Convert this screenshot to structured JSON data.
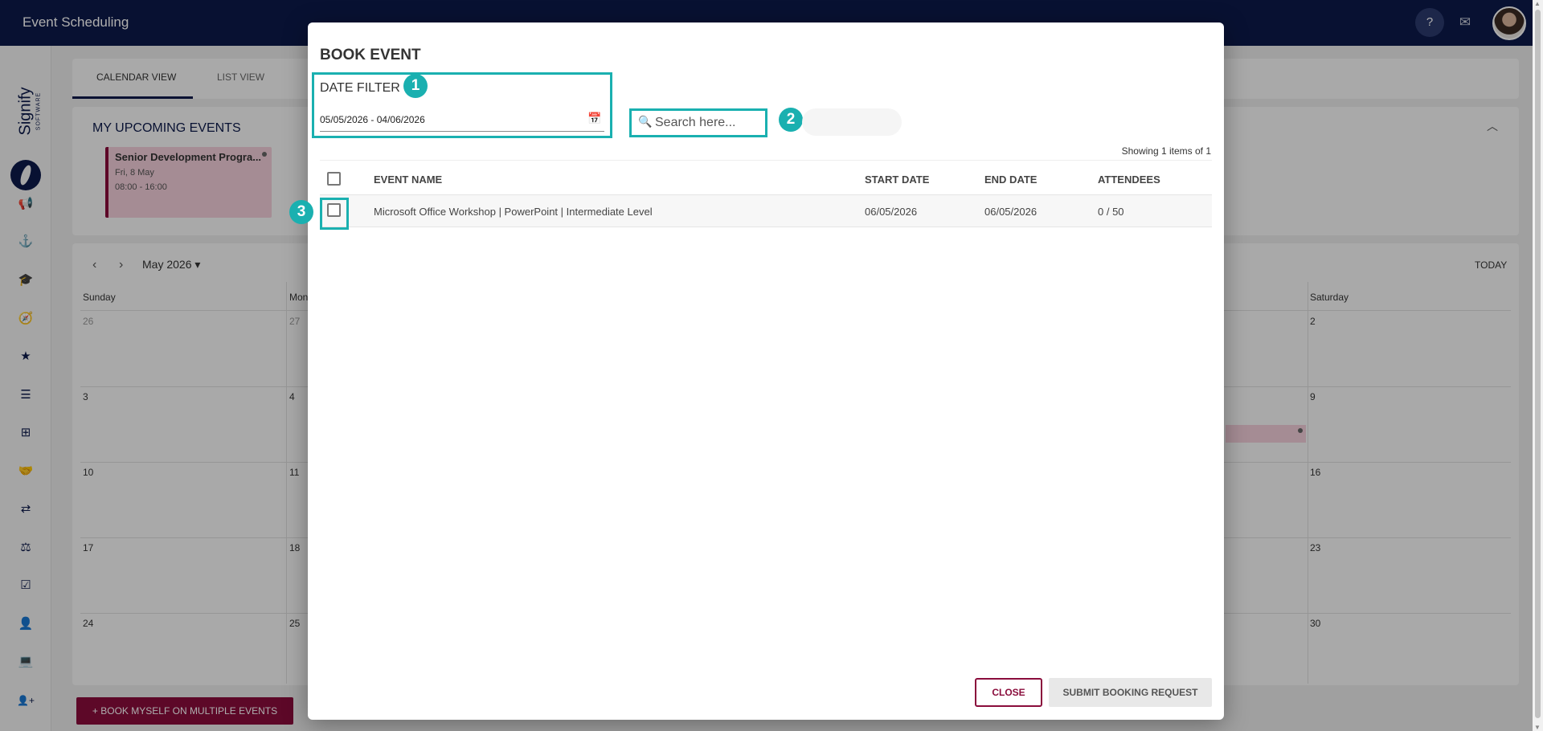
{
  "app": {
    "title": "Event Scheduling"
  },
  "topbar": {
    "help_label": "?",
    "mail_icon": "✉"
  },
  "sidebar": {
    "brand_word": "Signify",
    "brand_sub": "SOFTWARE",
    "icons": [
      "megaphone-icon",
      "anchor-icon",
      "graduation-cap-icon",
      "compass-icon",
      "star-icon",
      "sliders-icon",
      "signpost-icon",
      "handshake-icon",
      "route-icon",
      "scales-icon",
      "checklist-icon",
      "briefcase-user-icon",
      "laptop-icon",
      "user-plus-icon"
    ],
    "glyphs": [
      "📢",
      "⚓",
      "🎓",
      "🧭",
      "★",
      "☰",
      "⊞",
      "🤝",
      "⇄",
      "⚖",
      "☑",
      "👤",
      "💻",
      "👤+"
    ]
  },
  "tabs": {
    "calendar_view": "CALENDAR VIEW",
    "list_view": "LIST VIEW"
  },
  "upcoming": {
    "title": "MY UPCOMING EVENTS",
    "event": {
      "name": "Senior Development Progra...",
      "date": "Fri, 8 May",
      "time": "08:00 - 16:00"
    }
  },
  "calendar": {
    "month": "May 2026",
    "today_label": "TODAY",
    "day_headers": [
      "Sunday",
      "Mon",
      "",
      "",
      "",
      "",
      "Saturday"
    ],
    "week_rows": [
      [
        "26",
        "27",
        "",
        "",
        "",
        "",
        "2"
      ],
      [
        "3",
        "4",
        "",
        "",
        "",
        "",
        "9"
      ],
      [
        "10",
        "11",
        "",
        "",
        "",
        "",
        "16"
      ],
      [
        "17",
        "18",
        "",
        "",
        "",
        "",
        "23"
      ],
      [
        "24",
        "25",
        "",
        "",
        "",
        "",
        "30"
      ]
    ]
  },
  "book_multiple_label": "+ BOOK MYSELF ON MULTIPLE EVENTS",
  "modal": {
    "title": "BOOK EVENT",
    "date_filter": {
      "label": "DATE FILTER",
      "value": "05/05/2026 - 04/06/2026"
    },
    "search": {
      "placeholder": "Search here..."
    },
    "showing": "Showing 1 items of 1",
    "columns": {
      "event_name": "EVENT NAME",
      "start_date": "START DATE",
      "end_date": "END DATE",
      "attendees": "ATTENDEES"
    },
    "rows": [
      {
        "event_name": "Microsoft Office Workshop | PowerPoint | Intermediate Level",
        "start_date": "06/05/2026",
        "end_date": "06/05/2026",
        "attendees": "0 / 50"
      }
    ],
    "close_label": "CLOSE",
    "submit_label": "SUBMIT BOOKING REQUEST",
    "badges": [
      "1",
      "2",
      "3"
    ]
  },
  "colors": {
    "navy": "#0d1a4a",
    "brand_maroon": "#8a0d3c",
    "highlight_teal": "#1ab0b0",
    "event_pink": "#f4cfda"
  }
}
